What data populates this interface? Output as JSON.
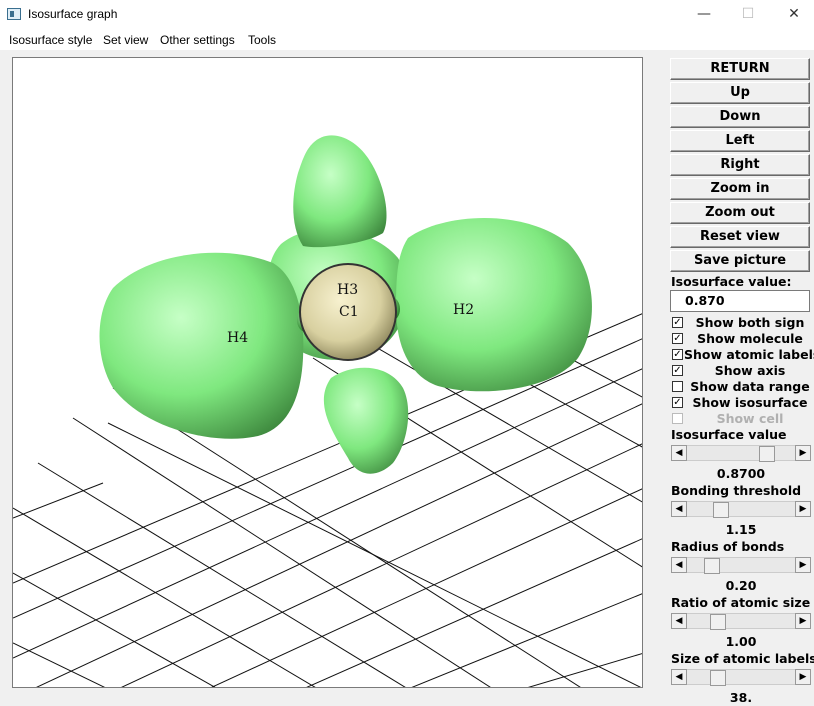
{
  "window": {
    "title": "Isosurface graph",
    "minimize": "—",
    "maximize": "☐",
    "close": "✕"
  },
  "menu": [
    "Isosurface style",
    "Set view",
    "Other settings",
    "Tools"
  ],
  "viewport": {
    "labels": {
      "h3": "H3",
      "c1": "C1",
      "h2": "H2",
      "h4": "H4"
    },
    "lobe_color": "#7fe87f",
    "atom_color": "#d8d0a0"
  },
  "buttons": [
    "RETURN",
    "Up",
    "Down",
    "Left",
    "Right",
    "Zoom in",
    "Zoom out",
    "Reset view",
    "Save picture"
  ],
  "isovalue": {
    "label": "Isosurface value:",
    "value": "0.870"
  },
  "checkboxes": [
    {
      "label": "Show both sign",
      "checked": true,
      "enabled": true
    },
    {
      "label": "Show molecule",
      "checked": true,
      "enabled": true
    },
    {
      "label": "Show atomic labels",
      "checked": true,
      "enabled": true
    },
    {
      "label": "Show axis",
      "checked": true,
      "enabled": true
    },
    {
      "label": "Show data range",
      "checked": false,
      "enabled": true
    },
    {
      "label": "Show isosurface",
      "checked": true,
      "enabled": true
    },
    {
      "label": "Show cell",
      "checked": false,
      "enabled": false
    }
  ],
  "sliders": [
    {
      "label": "Isosurface value",
      "value": "0.8700",
      "level": 0.78
    },
    {
      "label": "Bonding threshold",
      "value": "1.15",
      "level": 0.28
    },
    {
      "label": "Radius of bonds",
      "value": "0.20",
      "level": 0.18
    },
    {
      "label": "Ratio of atomic size",
      "value": "1.00",
      "level": 0.25
    },
    {
      "label": "Size of atomic labels",
      "value": "38.",
      "level": 0.25
    }
  ],
  "scroll_arrows": {
    "left": "◀",
    "right": "▶"
  },
  "check_mark": "✓"
}
